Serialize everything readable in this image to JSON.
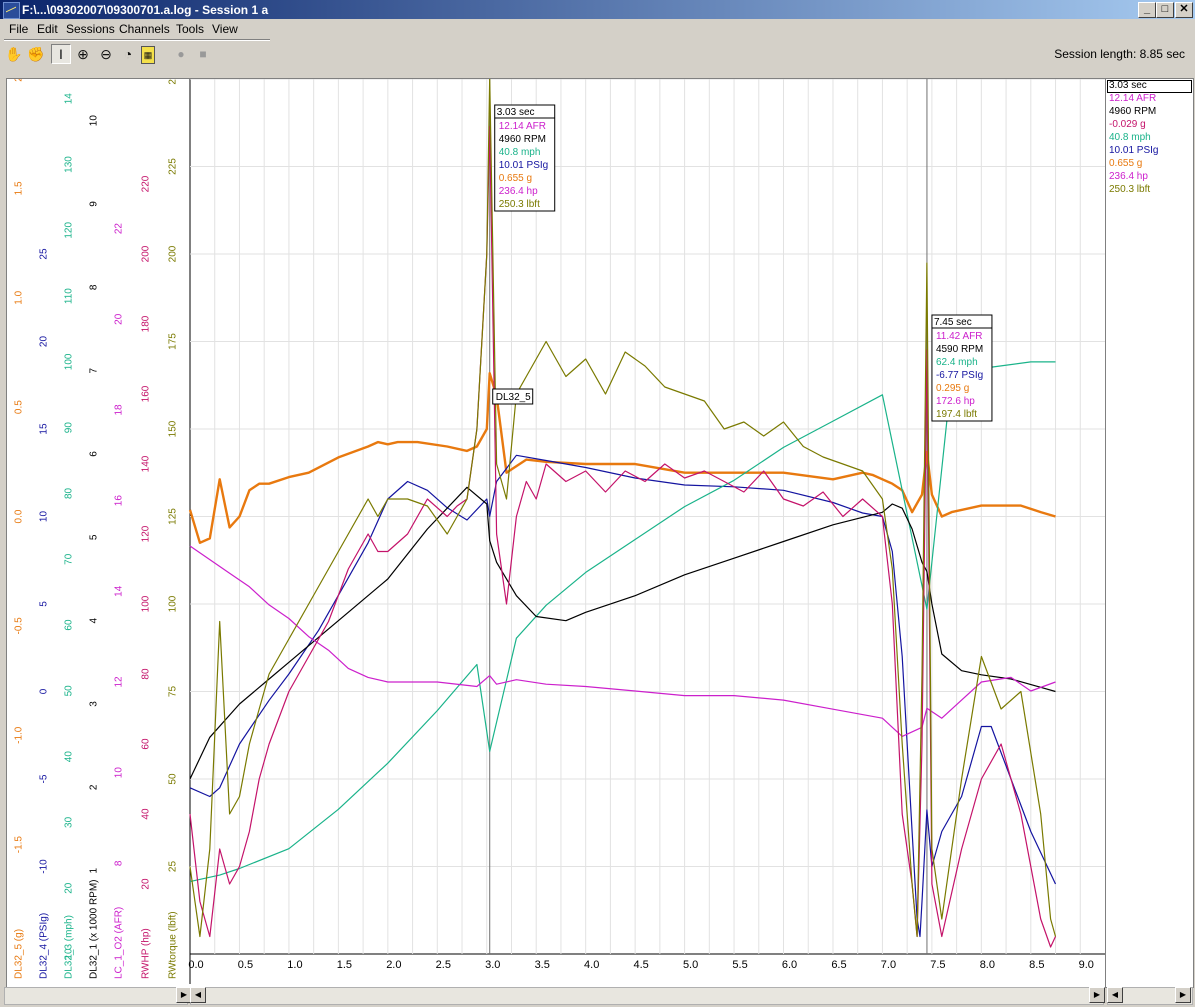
{
  "window": {
    "title": "F:\\...\\09302007\\09300701.a.log - Session 1 a",
    "buttons": [
      "_",
      "□",
      "✕"
    ]
  },
  "menu": [
    "File",
    "Edit",
    "Sessions",
    "Channels",
    "Tools",
    "View"
  ],
  "toolbar": {
    "icons": [
      "hand-icon",
      "grab-icon",
      "cursor-icon",
      "zoom-in-icon",
      "zoom-out-icon",
      "gauge-icon",
      "calculator-icon",
      "record-icon",
      "stop-icon"
    ]
  },
  "session_length": "Session length:  8.85 sec",
  "colors": {
    "DL32_5": "#e8790f",
    "DL32_4": "#1414a0",
    "DL32_3": "#1ab38a",
    "DL32_1": "#000000",
    "AFR": "#cc20cc",
    "RWHP": "#c4136a",
    "RWtorque": "#7a7a00"
  },
  "chart_data": {
    "type": "line",
    "xlabel": "",
    "x_ticks": [
      "0.0",
      "0.5",
      "1.0",
      "1.5",
      "2.0",
      "2.5",
      "3.0",
      "3.5",
      "4.0",
      "4.5",
      "5.0",
      "5.5",
      "6.0",
      "6.5",
      "7.0",
      "7.5",
      "8.0",
      "8.5",
      "9.0"
    ],
    "xlim": [
      0,
      9.25
    ],
    "grid": true,
    "cursors": [
      3.03,
      7.45
    ],
    "axes": [
      {
        "id": "DL32_5",
        "label": "DL32_5 (g)",
        "min": -2.0,
        "max": 2.0,
        "ticks": [
          "-1.5",
          "-1.0",
          "-0.5",
          "0.0",
          "0.5",
          "1.0",
          "1.5",
          "2"
        ],
        "tick_values": [
          -1.5,
          -1.0,
          -0.5,
          0.0,
          0.5,
          1.0,
          1.5,
          2.0
        ]
      },
      {
        "id": "DL32_4",
        "label": "DL32_4 (PSIg)",
        "min": -15,
        "max": 35,
        "ticks": [
          "-10",
          "-5",
          "0",
          "5",
          "10",
          "15",
          "20",
          "25"
        ],
        "tick_values": [
          -10,
          -5,
          0,
          5,
          10,
          15,
          20,
          25
        ]
      },
      {
        "id": "DL32_3",
        "label": "DL32_3 (mph)",
        "min": 10,
        "max": 143,
        "ticks": [
          "10",
          "20",
          "30",
          "40",
          "50",
          "60",
          "70",
          "80",
          "90",
          "100",
          "110",
          "120",
          "130",
          "14"
        ],
        "tick_values": [
          10,
          20,
          30,
          40,
          50,
          60,
          70,
          80,
          90,
          100,
          110,
          120,
          130,
          140
        ]
      },
      {
        "id": "DL32_1",
        "label": "DL32_1 (x 1000 RPM)",
        "min": 0,
        "max": 10.5,
        "ticks": [
          "1",
          "2",
          "3",
          "4",
          "5",
          "6",
          "7",
          "8",
          "9",
          "10"
        ],
        "tick_values": [
          1,
          2,
          3,
          4,
          5,
          6,
          7,
          8,
          9,
          10
        ]
      },
      {
        "id": "AFR",
        "label": "LC_1_O2 (AFR)",
        "min": 6,
        "max": 25.3,
        "ticks": [
          "8",
          "10",
          "12",
          "14",
          "16",
          "18",
          "20",
          "22"
        ],
        "tick_values": [
          8,
          10,
          12,
          14,
          16,
          18,
          20,
          22
        ]
      },
      {
        "id": "RWHP",
        "label": "RWHP (hp)",
        "min": 0,
        "max": 250,
        "ticks": [
          "20",
          "40",
          "60",
          "80",
          "100",
          "120",
          "140",
          "160",
          "180",
          "200",
          "220"
        ],
        "tick_values": [
          20,
          40,
          60,
          80,
          100,
          120,
          140,
          160,
          180,
          200,
          220
        ]
      },
      {
        "id": "RWtorque",
        "label": "RWtorque (lbft)",
        "min": 0,
        "max": 250,
        "ticks": [
          "25",
          "50",
          "75",
          "100",
          "125",
          "150",
          "175",
          "200",
          "225",
          "25"
        ],
        "tick_values": [
          25,
          50,
          75,
          100,
          125,
          150,
          175,
          200,
          225,
          250
        ]
      }
    ],
    "series": [
      {
        "name": "DL32_5",
        "axis": "DL32_5",
        "x": [
          0.0,
          0.1,
          0.2,
          0.3,
          0.4,
          0.5,
          0.6,
          0.7,
          0.8,
          1.0,
          1.2,
          1.5,
          1.8,
          1.9,
          2.0,
          2.1,
          2.3,
          2.6,
          2.8,
          2.9,
          3.0,
          3.03,
          3.1,
          3.2,
          3.4,
          3.6,
          4.0,
          4.5,
          5.0,
          5.5,
          6.0,
          6.5,
          6.8,
          6.9,
          7.0,
          7.1,
          7.2,
          7.3,
          7.4,
          7.45,
          7.5,
          7.6,
          7.7,
          8.0,
          8.4,
          8.6,
          8.75
        ],
        "y": [
          0.03,
          -0.12,
          -0.1,
          0.17,
          -0.05,
          0.0,
          0.12,
          0.15,
          0.15,
          0.18,
          0.2,
          0.27,
          0.32,
          0.34,
          0.33,
          0.34,
          0.34,
          0.32,
          0.3,
          0.32,
          0.4,
          0.655,
          0.55,
          0.2,
          0.26,
          0.25,
          0.24,
          0.24,
          0.2,
          0.2,
          0.2,
          0.17,
          0.2,
          0.19,
          0.17,
          0.15,
          0.12,
          0.02,
          0.1,
          0.295,
          0.1,
          0.0,
          0.02,
          0.05,
          0.05,
          0.02,
          0.0
        ]
      },
      {
        "name": "DL32_4",
        "axis": "DL32_4",
        "x": [
          0.0,
          0.2,
          0.3,
          0.5,
          0.8,
          1.0,
          1.3,
          1.6,
          1.8,
          2.0,
          2.2,
          2.4,
          2.6,
          2.8,
          3.0,
          3.03,
          3.1,
          3.3,
          3.6,
          4.0,
          4.5,
          5.0,
          5.5,
          6.0,
          6.5,
          6.8,
          7.0,
          7.1,
          7.2,
          7.3,
          7.35,
          7.38,
          7.4,
          7.45,
          7.5,
          7.6,
          7.8,
          8.0,
          8.1,
          8.3,
          8.5,
          8.75
        ],
        "y": [
          -5.5,
          -6.0,
          -5.5,
          -3.0,
          -0.5,
          1.0,
          3.5,
          6.5,
          8.5,
          11.0,
          12.0,
          11.5,
          10.5,
          9.8,
          11.0,
          10.01,
          12.0,
          13.5,
          13.2,
          12.8,
          12.2,
          11.8,
          11.7,
          11.5,
          10.8,
          10.2,
          10.0,
          8.0,
          2.0,
          -8.0,
          -13.0,
          -14.0,
          -12.0,
          -6.77,
          -10.0,
          -8.0,
          -6.0,
          -2.0,
          -2.0,
          -5.0,
          -8.0,
          -11.0
        ]
      },
      {
        "name": "DL32_3",
        "axis": "DL32_3",
        "x": [
          0.0,
          0.3,
          0.5,
          1.0,
          1.5,
          2.0,
          2.5,
          2.9,
          3.03,
          3.3,
          3.6,
          4.0,
          4.5,
          5.0,
          5.5,
          6.0,
          6.5,
          7.0,
          7.45,
          7.7,
          8.0,
          8.5,
          8.75
        ],
        "y": [
          21,
          22,
          23,
          26,
          32,
          39,
          47,
          54,
          40.8,
          58,
          63,
          68,
          73,
          78,
          82,
          87,
          91,
          95,
          62.4,
          98,
          99,
          100,
          100
        ]
      },
      {
        "name": "DL32_1",
        "axis": "DL32_1",
        "x": [
          0.0,
          0.2,
          0.5,
          0.8,
          1.0,
          1.3,
          1.6,
          2.0,
          2.4,
          2.8,
          3.0,
          3.03,
          3.1,
          3.3,
          3.5,
          3.8,
          4.0,
          4.5,
          5.0,
          5.5,
          6.0,
          6.5,
          7.0,
          7.1,
          7.2,
          7.3,
          7.4,
          7.45,
          7.5,
          7.6,
          7.8,
          8.0,
          8.3,
          8.6,
          8.75
        ],
        "y": [
          2.1,
          2.6,
          3.0,
          3.3,
          3.5,
          3.8,
          4.1,
          4.5,
          5.1,
          5.6,
          5.4,
          4.96,
          4.7,
          4.3,
          4.05,
          4.0,
          4.1,
          4.3,
          4.55,
          4.75,
          4.95,
          5.15,
          5.3,
          5.4,
          5.35,
          5.1,
          4.7,
          4.59,
          4.2,
          3.6,
          3.4,
          3.35,
          3.3,
          3.2,
          3.15
        ]
      },
      {
        "name": "LC_1_O2",
        "axis": "AFR",
        "x": [
          0.0,
          0.2,
          0.4,
          0.6,
          0.8,
          1.0,
          1.2,
          1.4,
          1.6,
          1.8,
          2.0,
          2.5,
          2.9,
          3.03,
          3.1,
          3.3,
          3.6,
          4.0,
          4.5,
          5.0,
          5.5,
          6.0,
          6.5,
          7.0,
          7.2,
          7.4,
          7.45,
          7.6,
          7.8,
          8.0,
          8.3,
          8.5,
          8.75
        ],
        "y": [
          15.0,
          14.7,
          14.4,
          14.1,
          13.7,
          13.4,
          13.0,
          12.7,
          12.3,
          12.1,
          12.0,
          12.0,
          11.9,
          12.14,
          11.95,
          12.05,
          11.95,
          11.9,
          11.8,
          11.7,
          11.7,
          11.6,
          11.4,
          11.2,
          10.8,
          11.0,
          11.42,
          11.2,
          11.6,
          12.0,
          12.1,
          11.8,
          12.0
        ]
      },
      {
        "name": "RWHP",
        "axis": "RWHP",
        "x": [
          0.0,
          0.1,
          0.2,
          0.3,
          0.4,
          0.5,
          0.6,
          0.7,
          0.8,
          1.0,
          1.2,
          1.4,
          1.6,
          1.8,
          1.9,
          2.0,
          2.2,
          2.4,
          2.6,
          2.7,
          2.8,
          2.9,
          3.0,
          3.03,
          3.1,
          3.2,
          3.3,
          3.4,
          3.5,
          3.6,
          3.8,
          4.0,
          4.2,
          4.4,
          4.6,
          4.8,
          5.0,
          5.2,
          5.4,
          5.6,
          5.8,
          6.0,
          6.2,
          6.4,
          6.6,
          6.8,
          7.0,
          7.1,
          7.2,
          7.3,
          7.35,
          7.4,
          7.45,
          7.5,
          7.6,
          7.8,
          8.0,
          8.2,
          8.4,
          8.6,
          8.7,
          8.75
        ],
        "y": [
          40,
          15,
          5,
          30,
          20,
          25,
          35,
          50,
          60,
          75,
          85,
          95,
          110,
          120,
          115,
          115,
          120,
          130,
          125,
          128,
          130,
          150,
          200,
          236.4,
          120,
          100,
          125,
          135,
          130,
          140,
          135,
          138,
          132,
          138,
          135,
          140,
          136,
          138,
          135,
          132,
          138,
          130,
          128,
          132,
          125,
          130,
          125,
          100,
          40,
          20,
          5,
          60,
          172.6,
          20,
          5,
          30,
          50,
          60,
          40,
          10,
          2,
          5
        ]
      },
      {
        "name": "RWtorque",
        "axis": "RWtorque",
        "x": [
          0.0,
          0.1,
          0.2,
          0.3,
          0.4,
          0.5,
          0.6,
          0.7,
          0.8,
          1.0,
          1.2,
          1.4,
          1.6,
          1.8,
          1.9,
          2.0,
          2.2,
          2.4,
          2.6,
          2.7,
          2.8,
          2.9,
          3.0,
          3.03,
          3.1,
          3.2,
          3.3,
          3.4,
          3.6,
          3.8,
          4.0,
          4.2,
          4.4,
          4.6,
          4.8,
          5.0,
          5.2,
          5.4,
          5.6,
          5.8,
          6.0,
          6.2,
          6.4,
          6.6,
          6.8,
          7.0,
          7.1,
          7.2,
          7.3,
          7.35,
          7.4,
          7.45,
          7.5,
          7.6,
          7.8,
          8.0,
          8.2,
          8.4,
          8.6,
          8.7,
          8.75
        ],
        "y": [
          25,
          5,
          30,
          95,
          40,
          45,
          60,
          70,
          80,
          90,
          100,
          110,
          120,
          130,
          125,
          130,
          130,
          128,
          120,
          125,
          130,
          150,
          200,
          250.3,
          140,
          130,
          160,
          165,
          175,
          165,
          170,
          160,
          172,
          168,
          162,
          160,
          158,
          150,
          152,
          148,
          152,
          145,
          142,
          140,
          138,
          130,
          110,
          60,
          20,
          5,
          80,
          197.4,
          30,
          10,
          50,
          85,
          70,
          75,
          40,
          10,
          5
        ]
      }
    ],
    "cursor_labels": [
      {
        "time": "3.03 sec",
        "values": [
          "12.14 AFR",
          "4960 RPM",
          "40.8 mph",
          "10.01 PSIg",
          "0.655 g",
          "236.4 hp",
          "250.3 lbft"
        ]
      },
      {
        "time": "7.45 sec",
        "values": [
          "11.42 AFR",
          "4590 RPM",
          "62.4 mph",
          "-6.77 PSIg",
          "0.295 g",
          "172.6 hp",
          "197.4 lbft"
        ]
      }
    ],
    "hover_label": "DL32_5",
    "legend_panel": {
      "time": "3.03 sec",
      "values": [
        "12.14 AFR",
        "4960 RPM",
        "-0.029 g",
        "40.8 mph",
        "10.01 PSIg",
        "0.655 g",
        "236.4 hp",
        "250.3 lbft"
      ]
    }
  }
}
